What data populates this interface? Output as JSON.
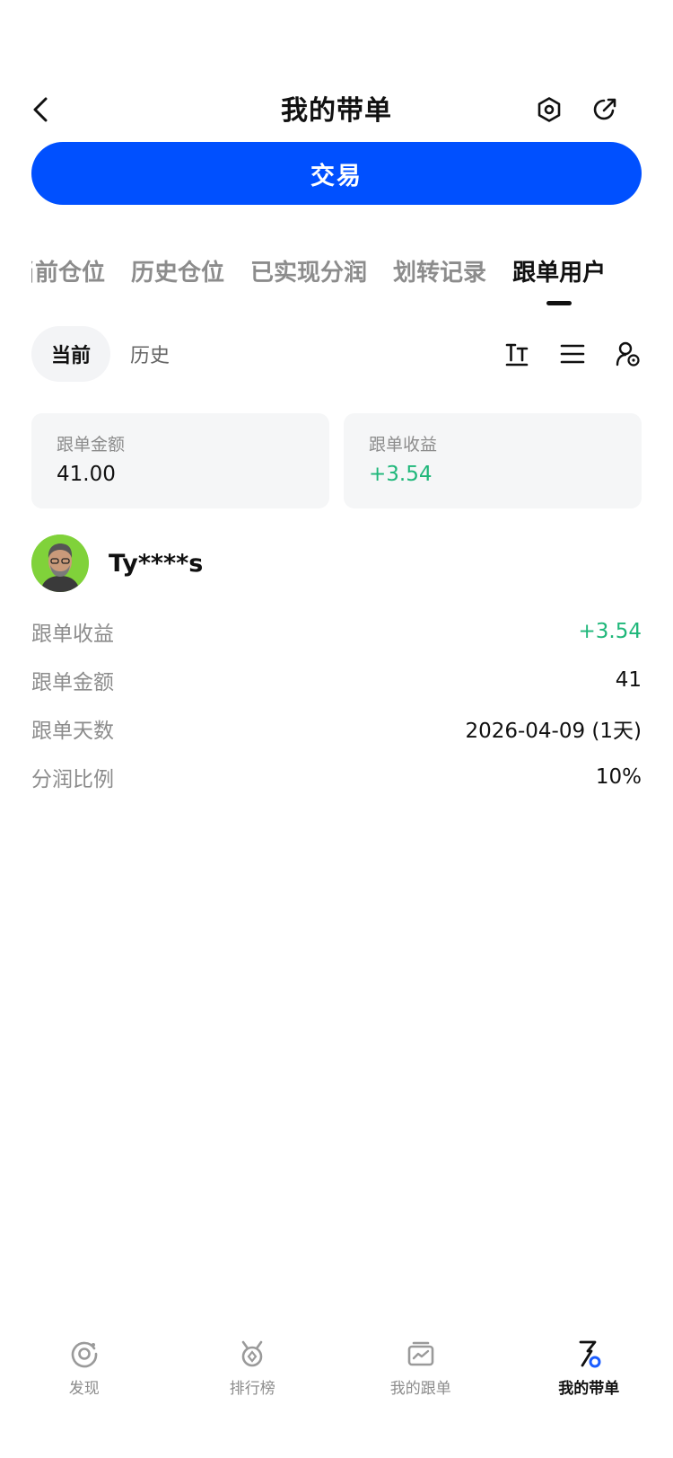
{
  "header": {
    "title": "我的带单"
  },
  "trade_button": {
    "label": "交易"
  },
  "tabs": [
    {
      "label": "当前仓位",
      "active": false
    },
    {
      "label": "历史仓位",
      "active": false
    },
    {
      "label": "已实现分润",
      "active": false
    },
    {
      "label": "划转记录",
      "active": false
    },
    {
      "label": "跟单用户",
      "active": true
    }
  ],
  "subtabs": [
    {
      "label": "当前",
      "active": true
    },
    {
      "label": "历史",
      "active": false
    }
  ],
  "summary": {
    "amount_label": "跟单金额",
    "amount_value": "41.00",
    "profit_label": "跟单收益",
    "profit_value": "+3.54"
  },
  "follower": {
    "name": "Ty****s",
    "rows": [
      {
        "label": "跟单收益",
        "value": "+3.54"
      },
      {
        "label": "跟单金额",
        "value": "41"
      },
      {
        "label": "跟单天数",
        "value": "2026-04-09 (1天)"
      },
      {
        "label": "分润比例",
        "value": "10%"
      }
    ]
  },
  "bottom_nav": [
    {
      "label": "发现",
      "icon": "discover-icon",
      "active": false
    },
    {
      "label": "排行榜",
      "icon": "ranking-icon",
      "active": false
    },
    {
      "label": "我的跟单",
      "icon": "my-copy-icon",
      "active": false
    },
    {
      "label": "我的带单",
      "icon": "my-lead-icon",
      "active": true
    }
  ],
  "colors": {
    "accent": "#0050ff",
    "profit": "#1fb77a",
    "card_bg": "#f5f6f7"
  }
}
